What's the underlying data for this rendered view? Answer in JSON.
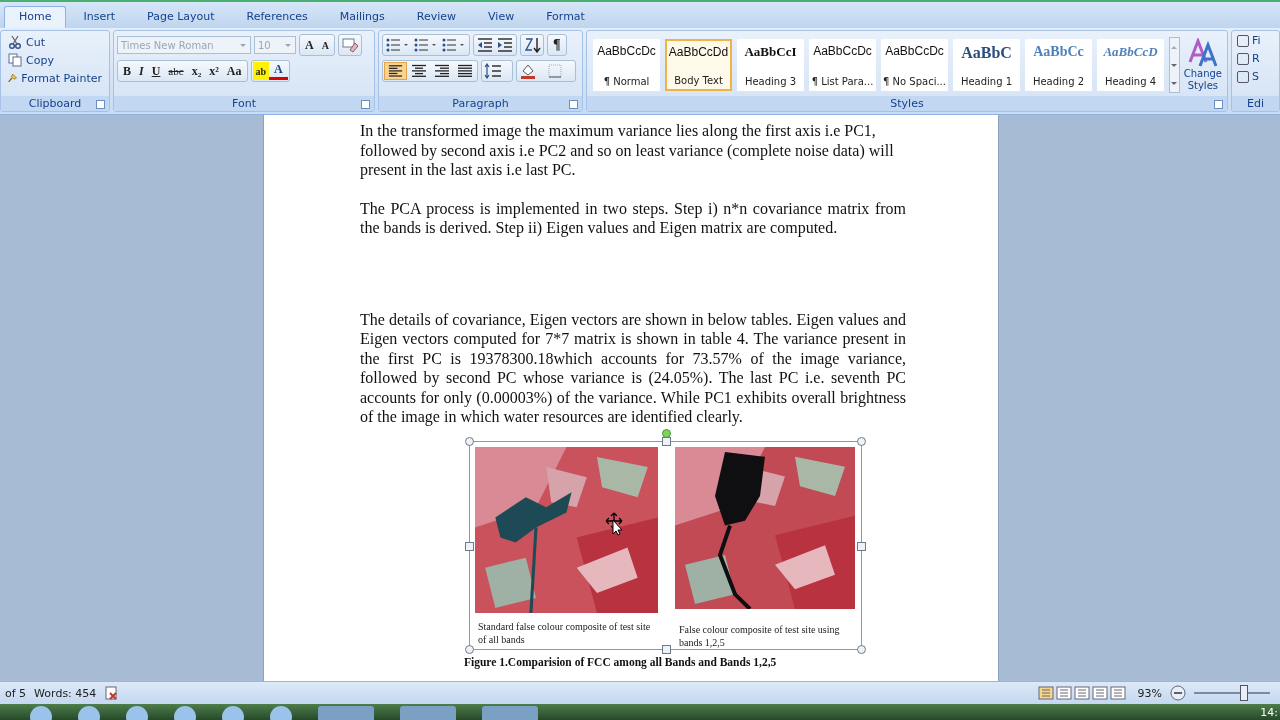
{
  "tabs": [
    {
      "label": "Home",
      "selected": true
    },
    {
      "label": "Insert",
      "selected": false
    },
    {
      "label": "Page Layout",
      "selected": false
    },
    {
      "label": "References",
      "selected": false
    },
    {
      "label": "Mailings",
      "selected": false
    },
    {
      "label": "Review",
      "selected": false
    },
    {
      "label": "View",
      "selected": false
    },
    {
      "label": "Format",
      "selected": false
    }
  ],
  "clipboard": {
    "label": "Clipboard",
    "items": [
      {
        "label": "Cut",
        "kind": "cut"
      },
      {
        "label": "Copy",
        "kind": "copy"
      },
      {
        "label": "Format Painter",
        "kind": "painter"
      }
    ]
  },
  "font": {
    "label": "Font",
    "font_name": "Times New Roman",
    "font_size": "10",
    "size_buttons": [
      "A",
      "A"
    ],
    "format_buttons": [
      "B",
      "I",
      "U",
      "abc",
      "x₂",
      "x²",
      "Aa"
    ],
    "highlight": "ab",
    "font_color": "A"
  },
  "paragraph": {
    "label": "Paragraph",
    "pilcrow": "¶",
    "align": [
      {
        "kind": "left",
        "selected": true
      },
      {
        "kind": "center",
        "selected": false
      },
      {
        "kind": "right",
        "selected": false
      },
      {
        "kind": "justify",
        "selected": false
      }
    ]
  },
  "styles": {
    "label": "Styles",
    "items": [
      {
        "preview": "AaBbCcDc",
        "name": "¶ Normal",
        "kind": "plain",
        "selected": false
      },
      {
        "preview": "AaBbCcDd",
        "name": "Body Text",
        "kind": "plain",
        "selected": true
      },
      {
        "preview": "AaBbCcI",
        "name": "Heading 3",
        "kind": "bold",
        "selected": false
      },
      {
        "preview": "AaBbCcDc",
        "name": "¶ List Para...",
        "kind": "plain",
        "selected": false
      },
      {
        "preview": "AaBbCcDc",
        "name": "¶ No Spaci...",
        "kind": "plain",
        "selected": false
      },
      {
        "preview": "AaBbC",
        "name": "Heading 1",
        "kind": "h1",
        "selected": false
      },
      {
        "preview": "AaBbCc",
        "name": "Heading 2",
        "kind": "h2",
        "selected": false
      },
      {
        "preview": "AaBbCcD",
        "name": "Heading 4",
        "kind": "h4",
        "selected": false
      }
    ],
    "change_styles": "Change Styles"
  },
  "editing": {
    "label": "Edi",
    "items": [
      "Fi",
      "R",
      "S"
    ]
  },
  "document": {
    "paragraphs": [
      "In the transformed image the maximum variance lies along the first axis i.e PC1, followed by second axis i.e PC2 and so on least variance (complete noise data) will present in the last axis i.e last PC.",
      "The PCA process is implemented in two steps.  Step i) n*n covariance matrix from the bands is derived. Step ii) Eigen values and Eigen matrix are computed.",
      "The details of covariance, Eigen vectors are shown in below tables. Eigen values and Eigen vectors computed for 7*7 matrix is shown in table 4. The variance present in the first PC is 19378300.18which accounts for 73.57% of the image variance, followed by second PC whose variance is (24.05%). The last PC i.e. seventh PC accounts for only (0.00003%) of the variance. While PC1 exhibits overall brightness of the image in which water resources are identified clearly."
    ],
    "figure": {
      "images": [
        {
          "kind": "picture",
          "caption": "Standard false colour composite of test site of all bands"
        },
        {
          "kind": "picture",
          "caption": "False colour composite of test site using bands 1,2,5"
        }
      ],
      "title": "Figure 1.Comparision of FCC among all Bands and Bands 1,2,5"
    }
  },
  "status_bar": {
    "page": "of 5",
    "words": "Words: 454",
    "zoom": "93%",
    "zoom_slider": {
      "level": 0.66
    }
  },
  "taskbar": {
    "clock": "14:"
  }
}
